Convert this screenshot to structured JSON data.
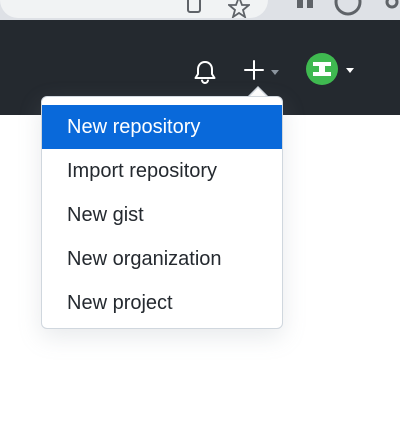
{
  "header": {
    "icons": {
      "notifications": "bell-icon",
      "create": "plus-icon",
      "create_caret": "caret-down-icon",
      "profile": "avatar",
      "profile_caret": "caret-down-icon"
    }
  },
  "browser": {
    "icons": [
      "install-icon",
      "bookmark-star-icon",
      "extension-icon",
      "profile-icon"
    ]
  },
  "create_menu": {
    "items": [
      {
        "label": "New repository",
        "active": true
      },
      {
        "label": "Import repository",
        "active": false
      },
      {
        "label": "New gist",
        "active": false
      },
      {
        "label": "New organization",
        "active": false
      },
      {
        "label": "New project",
        "active": false
      }
    ]
  },
  "colors": {
    "header_bg": "#24292f",
    "accent": "#0969da",
    "avatar": "#3fb950"
  }
}
